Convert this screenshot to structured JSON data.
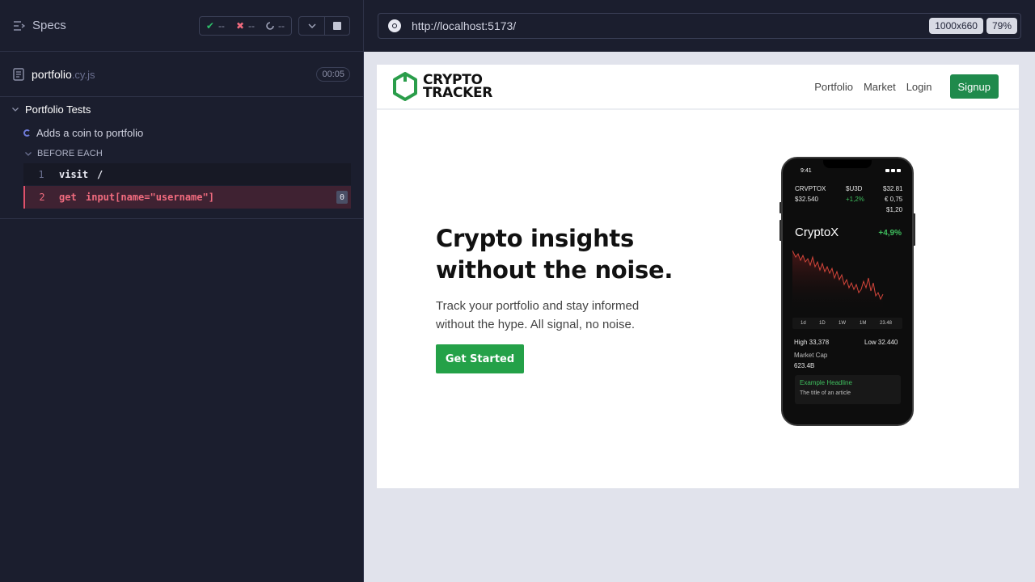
{
  "runner": {
    "specs_label": "Specs",
    "stats": {
      "passed": "--",
      "failed": "--",
      "pending": "--"
    },
    "spec_file": {
      "name": "portfolio",
      "ext": ".cy.js",
      "duration": "00:05"
    },
    "suite": "Portfolio Tests",
    "test": "Adds a coin to portfolio",
    "hook": "BEFORE EACH",
    "commands": [
      {
        "num": "1",
        "name": "visit",
        "message": "/"
      },
      {
        "num": "2",
        "name": "get",
        "message": "input[name=\"username\"]",
        "badge": "0"
      }
    ]
  },
  "browser": {
    "url": "http://localhost:5173/",
    "viewport_size": "1000x660",
    "zoom": "79%"
  },
  "app": {
    "logo_line1": "CRYPTO",
    "logo_line2": "TRACKER",
    "nav": [
      "Portfolio",
      "Market",
      "Login"
    ],
    "signup": "Signup",
    "hero_title": "Crypto insights without the noise.",
    "hero_sub": "Track your portfolio and stay informed without the hype. All signal, no noise.",
    "cta": "Get Started",
    "phone": {
      "time": "9:41",
      "tickers": [
        [
          "CRVPTOX",
          "$U3D",
          "$32.81"
        ],
        [
          "$32.540",
          "+1,2%",
          "€ 0,75"
        ],
        [
          "",
          "",
          "$1,20"
        ]
      ],
      "coin": "CryptoX",
      "change": "+4,9%",
      "periods": [
        "1d",
        "1D",
        "1W",
        "1M",
        "23.48"
      ],
      "high": "High 33,378",
      "low": "Low 32.440",
      "market_cap_label": "Market Cap",
      "market_cap": "623.4B",
      "headline": "Example Headline",
      "article": "The title of an article"
    }
  },
  "colors": {
    "runner_bg": "#1b1e2e",
    "brand_green": "#1f8a4c",
    "cta_green": "#24a148",
    "error_red": "#f06b7e"
  }
}
